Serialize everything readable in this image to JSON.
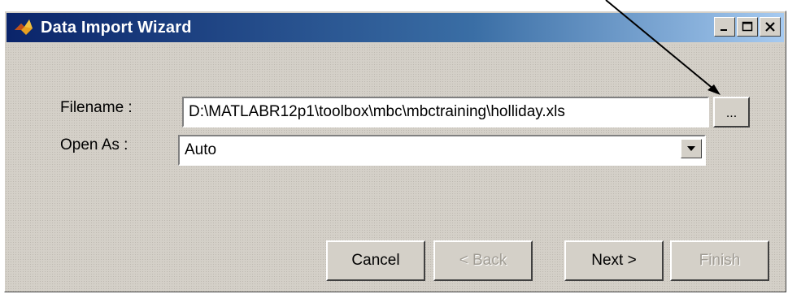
{
  "window": {
    "title": "Data Import Wizard"
  },
  "form": {
    "filename_label": "Filename :",
    "filename_value": "D:\\MATLABR12p1\\toolbox\\mbc\\mbctraining\\holliday.xls",
    "browse_label": "...",
    "open_as_label": "Open As :",
    "open_as_value": "Auto"
  },
  "buttons": {
    "cancel": "Cancel",
    "back": "< Back",
    "next": "Next >",
    "finish": "Finish"
  },
  "colors": {
    "titlebar_start": "#0a246a",
    "titlebar_end": "#a6caf0",
    "face": "#d4d0c8"
  }
}
